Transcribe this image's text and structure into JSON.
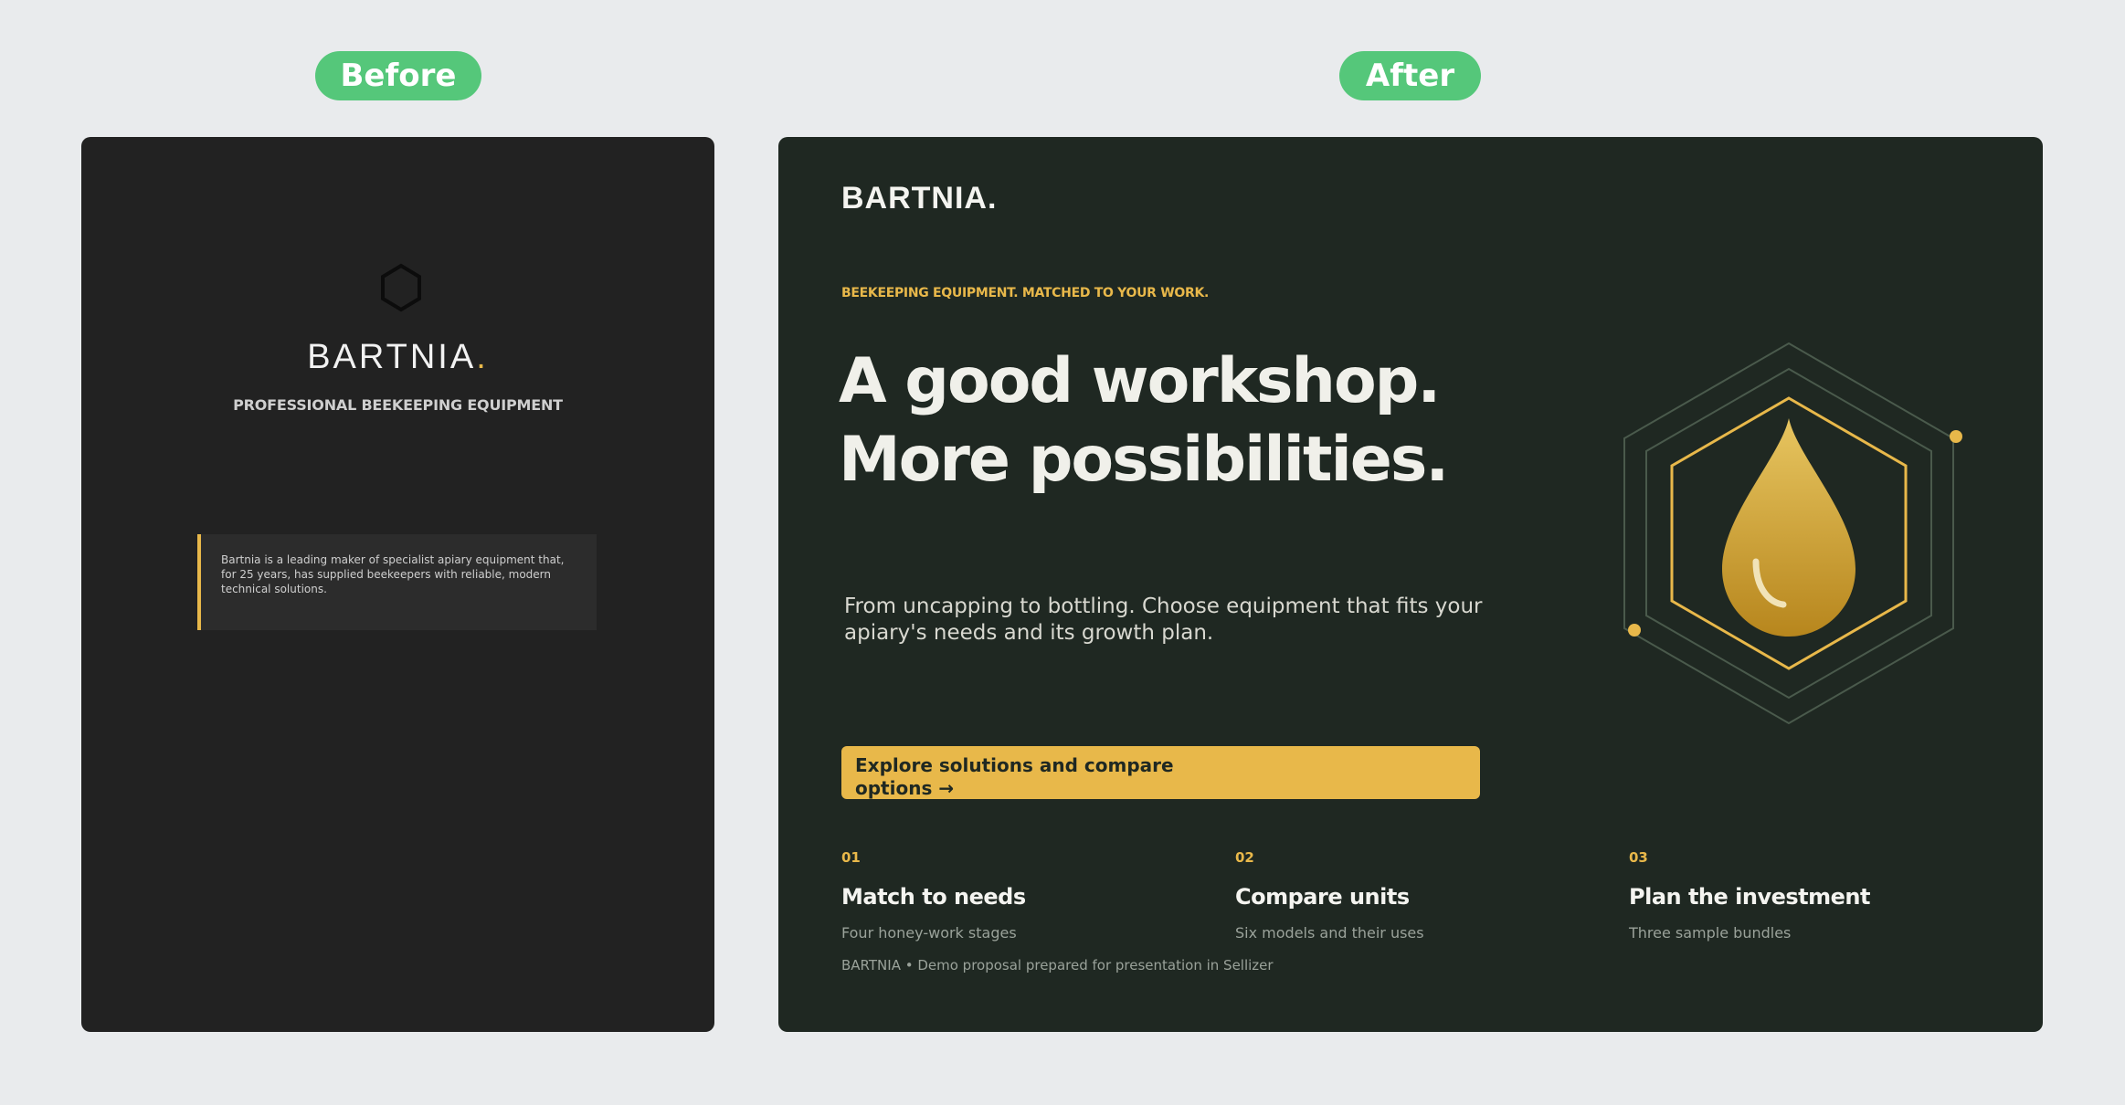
{
  "labels": {
    "before": "Before",
    "after": "After"
  },
  "before": {
    "icon": "hexagon-outline-icon",
    "brand": "BARTNIA",
    "brand_dot": ".",
    "tagline": "PROFESSIONAL BEEKEEPING EQUIPMENT",
    "quote": "Bartnia is a leading maker of specialist apiary equipment that, for 25 years, has supplied beekeepers with reliable, modern technical solutions."
  },
  "after": {
    "logo": "BARTNIA.",
    "kicker": "BEEKEEPING EQUIPMENT. MATCHED TO YOUR WORK.",
    "headline_line1": "A good workshop.",
    "headline_line2": "More possibilities.",
    "subcopy": "From uncapping to bottling. Choose equipment that fits your apiary's needs and its growth plan.",
    "cta_label": "Explore solutions and compare options →",
    "steps": [
      {
        "number": "01",
        "title": "Match to needs",
        "desc": "Four honey-work stages"
      },
      {
        "number": "02",
        "title": "Compare units",
        "desc": "Six models and their uses"
      },
      {
        "number": "03",
        "title": "Plan the investment",
        "desc": "Three sample bundles"
      }
    ],
    "footer": "BARTNIA • Demo proposal prepared for presentation in Sellizer",
    "graphic_icon": "honey-drop-hexagon-icon"
  },
  "colors": {
    "page_bg": "#e9ebed",
    "pill": "#55c77a",
    "before_bg": "#222222",
    "after_bg": "#1f2822",
    "accent": "#e8b84a"
  }
}
